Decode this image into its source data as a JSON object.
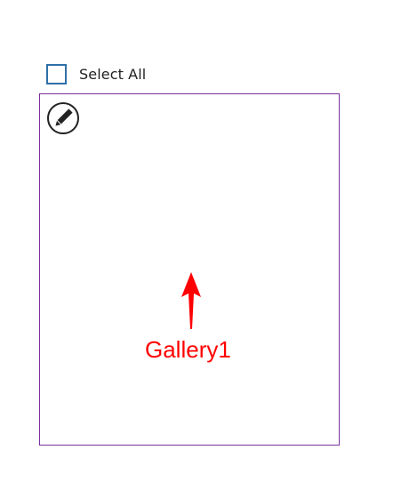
{
  "select_all": {
    "label": "Select All",
    "checked": false,
    "checkbox_border_color": "#2f6fa7"
  },
  "gallery": {
    "border_color": "#7a2f9e",
    "edit_icon": "pencil-edit-icon",
    "annotation": {
      "text": "Gallery1",
      "color": "#ff0000",
      "arrow_icon": "arrow-up-icon"
    }
  }
}
